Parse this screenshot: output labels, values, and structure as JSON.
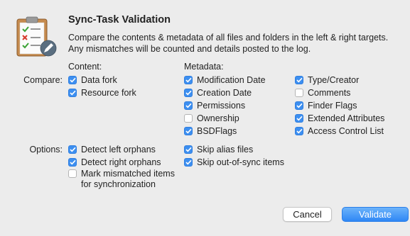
{
  "dialog": {
    "title": "Sync-Task Validation",
    "description": "Compare the contents & metadata of all files and folders in the left & right targets. Any mismatches will be counted and details posted to the log."
  },
  "headers": {
    "content": "Content:",
    "metadata": "Metadata:"
  },
  "compare": {
    "label": "Compare:",
    "content": [
      {
        "label": "Data fork",
        "checked": true
      },
      {
        "label": "Resource fork",
        "checked": true
      }
    ],
    "metadata_col1": [
      {
        "label": "Modification Date",
        "checked": true
      },
      {
        "label": "Creation Date",
        "checked": true
      },
      {
        "label": "Permissions",
        "checked": true
      },
      {
        "label": "Ownership",
        "checked": false
      },
      {
        "label": "BSDFlags",
        "checked": true
      }
    ],
    "metadata_col2": [
      {
        "label": "Type/Creator",
        "checked": true
      },
      {
        "label": "Comments",
        "checked": false
      },
      {
        "label": "Finder Flags",
        "checked": true
      },
      {
        "label": "Extended Attributes",
        "checked": true
      },
      {
        "label": "Access Control List",
        "checked": true
      }
    ]
  },
  "options": {
    "label": "Options:",
    "col1": [
      {
        "label": "Detect left orphans",
        "checked": true
      },
      {
        "label": "Detect right orphans",
        "checked": true
      },
      {
        "label": "Mark mismatched items\nfor synchronization",
        "checked": false
      }
    ],
    "col2": [
      {
        "label": "Skip alias files",
        "checked": true
      },
      {
        "label": "Skip out-of-sync items",
        "checked": true
      }
    ]
  },
  "buttons": {
    "cancel": "Cancel",
    "validate": "Validate"
  },
  "colors": {
    "accent": "#3d8ff0",
    "background": "#ececec"
  },
  "icons": {
    "app": "clipboard-checklist-icon",
    "check": "checkmark-icon"
  }
}
